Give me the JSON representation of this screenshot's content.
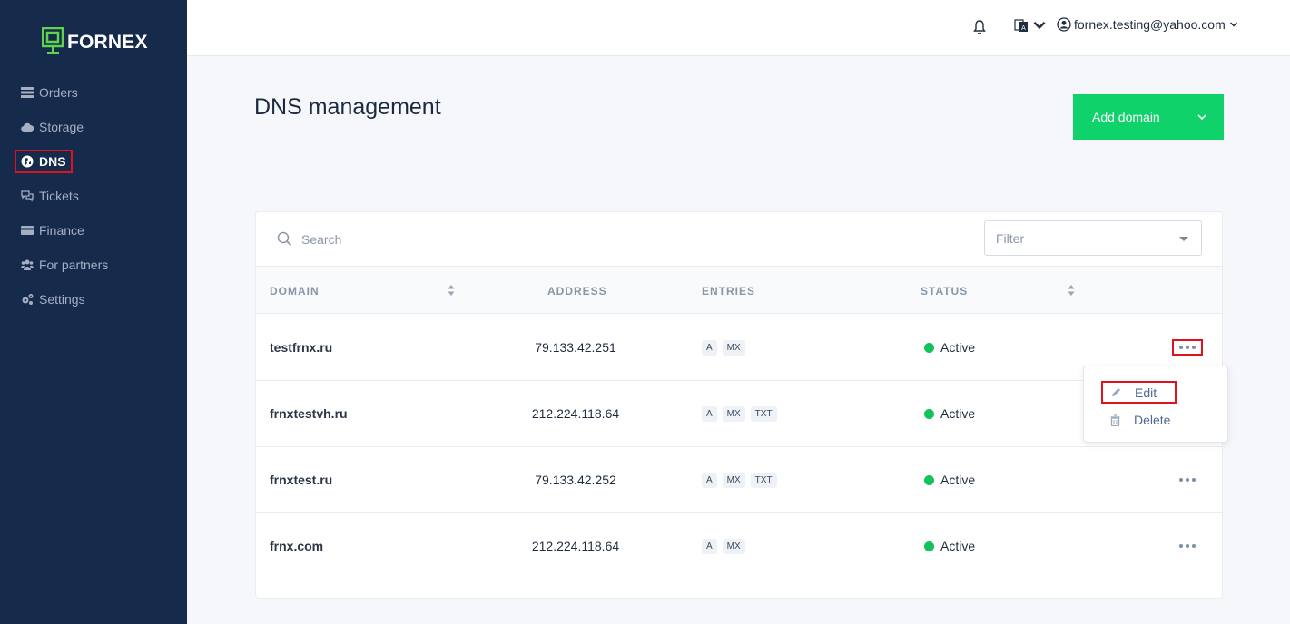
{
  "brand": {
    "name": "FORNEX",
    "logo_color": "#5fd34a"
  },
  "sidebar": {
    "items": [
      {
        "label": "Orders",
        "icon": "orders-icon"
      },
      {
        "label": "Storage",
        "icon": "cloud-icon"
      },
      {
        "label": "DNS",
        "icon": "globe-icon",
        "active": true
      },
      {
        "label": "Tickets",
        "icon": "chat-icon"
      },
      {
        "label": "Finance",
        "icon": "card-icon"
      },
      {
        "label": "For partners",
        "icon": "users-icon"
      },
      {
        "label": "Settings",
        "icon": "gears-icon"
      }
    ]
  },
  "topbar": {
    "user_email": "fornex.testing@yahoo.com",
    "icons": [
      "bell-icon",
      "language-icon",
      "user-icon"
    ]
  },
  "page": {
    "title": "DNS management",
    "add_button": "Add domain"
  },
  "table": {
    "search_placeholder": "Search",
    "filter_placeholder": "Filter",
    "headers": {
      "domain": "DOMAIN",
      "address": "ADDRESS",
      "entries": "ENTRIES",
      "status": "STATUS"
    },
    "rows": [
      {
        "domain": "testfrnx.ru",
        "address": "79.133.42.251",
        "entries": [
          "A",
          "MX"
        ],
        "status": "Active"
      },
      {
        "domain": "frnxtestvh.ru",
        "address": "212.224.118.64",
        "entries": [
          "A",
          "MX",
          "TXT"
        ],
        "status": "Active"
      },
      {
        "domain": "frnxtest.ru",
        "address": "79.133.42.252",
        "entries": [
          "A",
          "MX",
          "TXT"
        ],
        "status": "Active"
      },
      {
        "domain": "frnx.com",
        "address": "212.224.118.64",
        "entries": [
          "A",
          "MX"
        ],
        "status": "Active"
      }
    ]
  },
  "context_menu": {
    "edit": "Edit",
    "delete": "Delete"
  },
  "colors": {
    "sidebar_bg": "#162a4c",
    "accent_green": "#10d26b",
    "status_active": "#12c25d",
    "highlight_red": "#e0121e"
  }
}
